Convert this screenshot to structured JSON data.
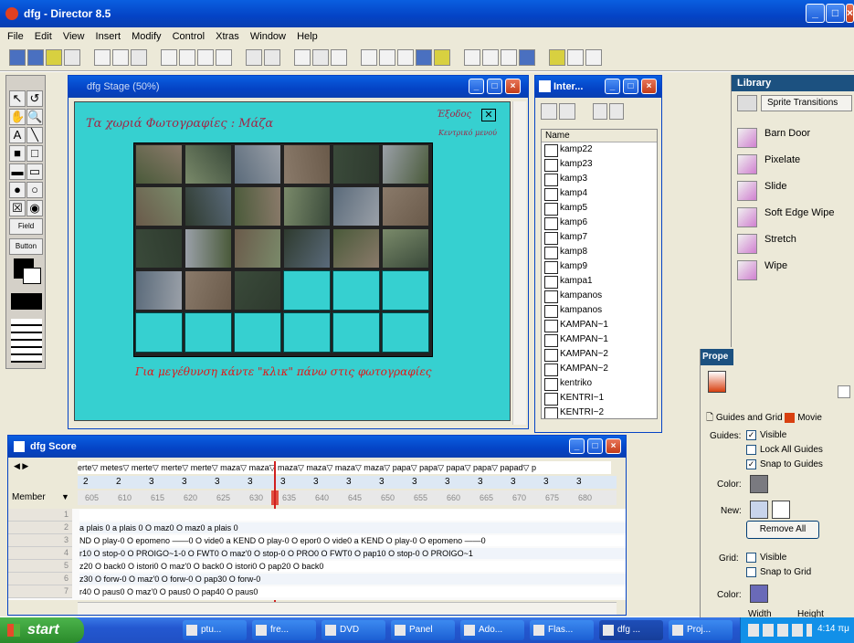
{
  "window": {
    "title": "dfg - Director 8.5",
    "icon": "director-app-icon"
  },
  "menu": [
    "File",
    "Edit",
    "View",
    "Insert",
    "Modify",
    "Control",
    "Xtras",
    "Window",
    "Help"
  ],
  "stage": {
    "title": "dfg Stage (50%)",
    "heading": "Τα χωριά Φωτογραφίες : Μάζα",
    "exit_label": "Έξοδος",
    "back_label": "Κεντρικό μενού",
    "footer": "Για μεγέθυνση κάντε \"κλικ\" πάνω στις φωτογραφίες"
  },
  "cast": {
    "title": "Inter...",
    "column": "Name",
    "items": [
      "kamp22",
      "kamp23",
      "kamp3",
      "kamp4",
      "kamp5",
      "kamp6",
      "kamp7",
      "kamp8",
      "kamp9",
      "kampa1",
      "kampanos",
      "kampanos",
      "KAMPAN~1",
      "KAMPAN~1",
      "KAMPAN~2",
      "KAMPAN~2",
      "kentriko",
      "KENTRI~1",
      "KENTRI~2"
    ]
  },
  "library": {
    "title": "Library",
    "category": "Sprite Transitions",
    "items": [
      "Barn Door",
      "Pixelate",
      "Slide",
      "Soft Edge Wipe",
      "Stretch",
      "Wipe"
    ]
  },
  "property": {
    "title": "Prope",
    "tab_guides": "Guides and Grid",
    "tab_movie": "Movie",
    "guides_label": "Guides:",
    "visible": "Visible",
    "lock": "Lock All Guides",
    "snap": "Snap to Guides",
    "color_label": "Color:",
    "new_label": "New:",
    "remove_all": "Remove All",
    "grid_label": "Grid:",
    "grid_visible": "Visible",
    "snap_grid": "Snap to Grid",
    "grid_color_label": "Color:",
    "width_label": "Width",
    "height_label": "Height"
  },
  "score": {
    "title": "dfg Score",
    "markers": "erte▽ metes▽ merte▽ merte▽ merte▽ maza▽ maza▽ maza▽ maza▽ maza▽ maza▽ papa▽ papa▽ papa▽ papa▽ papad▽ p",
    "tempo": [
      "2",
      "2",
      "3",
      "3",
      "3",
      "3",
      "3",
      "3",
      "3",
      "3",
      "3",
      "3",
      "3",
      "3",
      "3",
      "3"
    ],
    "member_label": "Member",
    "frames": [
      "605",
      "610",
      "615",
      "620",
      "625",
      "630",
      "635",
      "640",
      "645",
      "650",
      "655",
      "660",
      "665",
      "670",
      "675",
      "680"
    ],
    "channels": [
      "1",
      "2",
      "3",
      "4",
      "5",
      "6",
      "7"
    ],
    "rows": [
      "",
      "    a plais 0                                                     a plais 0 O maz0 O maz0                                      a plais 0",
      "ND O play-0 O epomeno ——0                     O vide0 a KEND O play-0 O epor0                                O vide0 a KEND O play-0 O epomeno ——0",
      "r10 O stop-0              O PROIGO~1-0 O FWT0 O maz'0 O stop-0                O PRO0             O FWT0 O pap10 O stop-0              O PROIGO~1",
      "z20 O back0                               O istori0 O maz'0 O back0                                          O istori0 O pap20 O back0",
      "z30 O forw-0                                          O maz'0 O forw-0                                                        O pap30 O forw-0",
      "r40 O paus0                                           O maz'0 O paus0                                                         O pap40 O paus0"
    ]
  },
  "taskbar": {
    "start": "start",
    "tasks": [
      "ptu...",
      "fre...",
      "DVD",
      "Panel",
      "Ado...",
      "Flas...",
      "dfg ...",
      "Proj..."
    ],
    "clock": "4:14 πμ"
  }
}
